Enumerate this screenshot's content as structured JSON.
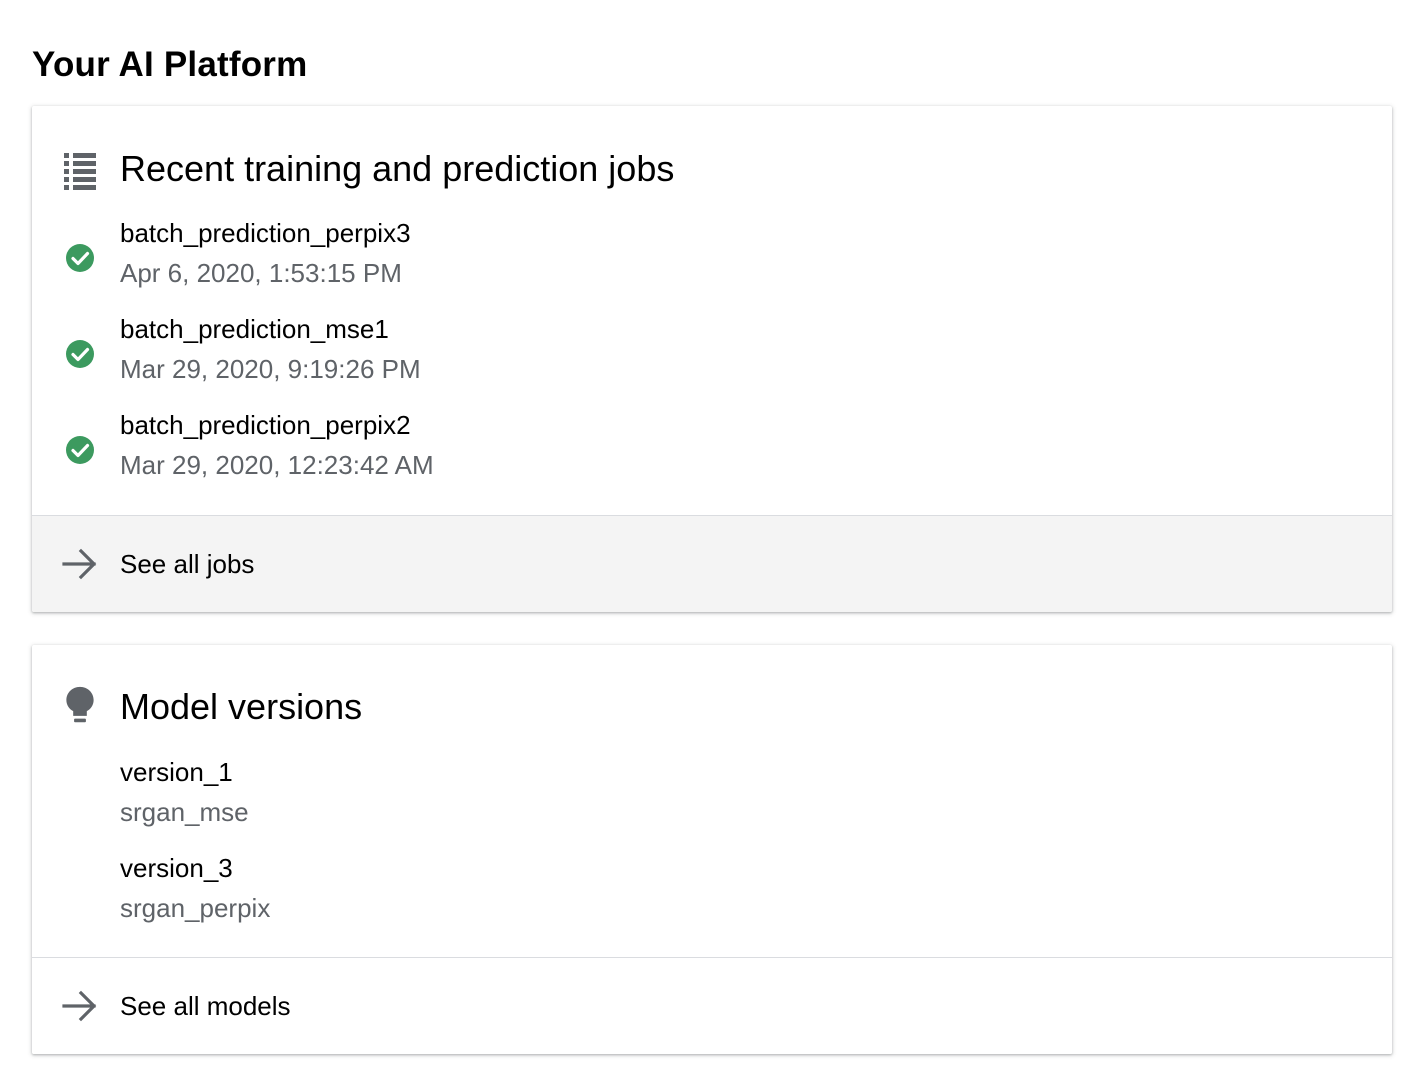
{
  "page": {
    "title": "Your AI Platform"
  },
  "jobs_card": {
    "title": "Recent training and prediction jobs",
    "header_icon": "list-icon",
    "items": [
      {
        "name": "batch_prediction_perpix3",
        "timestamp": "Apr 6, 2020, 1:53:15 PM",
        "status_icon": "check-circle-icon"
      },
      {
        "name": "batch_prediction_mse1",
        "timestamp": "Mar 29, 2020, 9:19:26 PM",
        "status_icon": "check-circle-icon"
      },
      {
        "name": "batch_prediction_perpix2",
        "timestamp": "Mar 29, 2020, 12:23:42 AM",
        "status_icon": "check-circle-icon"
      }
    ],
    "footer_label": "See all jobs",
    "footer_icon": "arrow-right-icon"
  },
  "models_card": {
    "title": "Model versions",
    "header_icon": "lightbulb-icon",
    "items": [
      {
        "version": "version_1",
        "model": "srgan_mse"
      },
      {
        "version": "version_3",
        "model": "srgan_perpix"
      }
    ],
    "footer_label": "See all models",
    "footer_icon": "arrow-right-icon"
  },
  "colors": {
    "success": "#3c9a5f",
    "icon_gray": "#5f6368",
    "footer_bg": "#f4f4f4",
    "divider": "#dadce0"
  }
}
